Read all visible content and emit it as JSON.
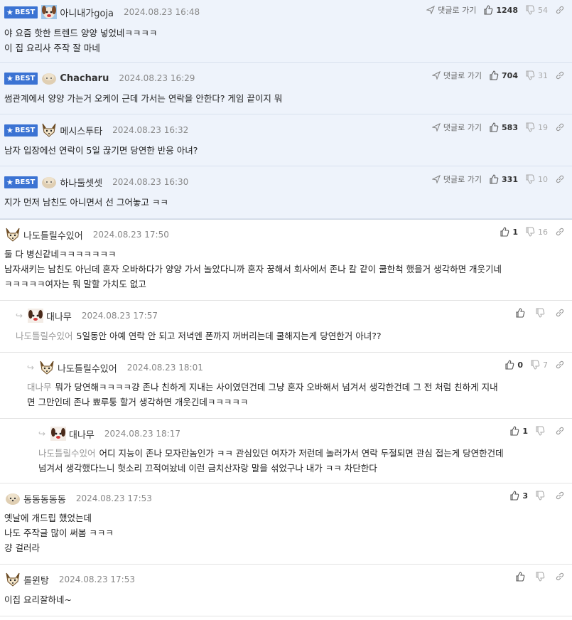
{
  "labels": {
    "best": "BEST",
    "goto": "댓글로 가기"
  },
  "best_comments": [
    {
      "nick": "아니내가goja",
      "date": "2024.08.23 16:48",
      "up": "1248",
      "down": "54",
      "text": "야 요즘 핫한 트렌드 양양 넣었네ㅋㅋㅋㅋ\n이 집 요리사 주작 잘 마네",
      "avatar": "dog-red-avatar"
    },
    {
      "nick": "Chacharu",
      "date": "2024.08.23 16:29",
      "up": "704",
      "down": "31",
      "text": "썸관계에서 양양 가는거 오케이 근데 가서는 연락을 안한다? 게임 끝이지 뭐",
      "avatar": "beige-dog-avatar"
    },
    {
      "nick": "메시스투타",
      "date": "2024.08.23 16:32",
      "up": "583",
      "down": "19",
      "text": "남자 입장에선 연락이 5일 끊기면 당연한 반응 아녀?",
      "avatar": "fox-avatar"
    },
    {
      "nick": "하나둘셋셋",
      "date": "2024.08.23 16:30",
      "up": "331",
      "down": "10",
      "text": "지가 먼저 남친도 아니면서 선 그어놓고 ㅋㅋ",
      "avatar": "beige-dog-avatar"
    }
  ],
  "comments": [
    {
      "nick": "나도틀릴수있어",
      "date": "2024.08.23 17:50",
      "up": "1",
      "down": "16",
      "depth": 0,
      "mention": "",
      "text": "둘 다 병신같네ㅋㅋㅋㅋㅋㅋㅋ\n남자새키는 남친도 아닌데 혼자 오바하다가 양양 가서 놀았다니까 혼자 꿍해서 회사에서 존나 칼 같이 쿨한척 했을거 생각하면 개웃기네\nㅋㅋㅋㅋㅋ여자는 뭐 말할 가치도 없고",
      "avatar": "fox-avatar"
    },
    {
      "nick": "대나무",
      "date": "2024.08.23 17:57",
      "up": "",
      "down": "",
      "depth": 1,
      "mention": "나도틀릴수있어",
      "text": "5일동안 아예 연락 안 되고 저녁엔 폰까지 꺼버리는데 쿨해지는게 당연한거 아녀??",
      "avatar": "dog-red-avatar"
    },
    {
      "nick": "나도틀릴수있어",
      "date": "2024.08.23 18:01",
      "up": "0",
      "down": "7",
      "depth": 2,
      "mention": "대나무",
      "text": "뭐가 당연해ㅋㅋㅋㅋ걍 존나 친하게 지내는 사이였던건데 그냥 혼자 오바해서 넘겨서 생각한건데 그 전 처럼 친하게 지내\n면 그만인데 존나 뾰루퉁 할거 생각하면 개웃긴데ㅋㅋㅋㅋㅋ",
      "avatar": "fox-avatar"
    },
    {
      "nick": "대나무",
      "date": "2024.08.23 18:17",
      "up": "1",
      "down": "",
      "depth": 3,
      "mention": "나도틀릴수있어",
      "text": "어디 지능이 존나 모자란놈인가 ㅋㅋ 관심있던 여자가 저런데 놀러가서 연락 두절되면 관심 접는게 당연한건데\n넘겨서 생각했다느니 헛소리 끄적여놨네 이런 금치산자랑 말을 섞었구나 내가 ㅋㅋ 차단한다",
      "avatar": "dog-red-avatar"
    },
    {
      "nick": "동동동동동",
      "date": "2024.08.23 17:53",
      "up": "3",
      "down": "",
      "depth": 0,
      "mention": "",
      "text": "옛날에 개드립 했었는데\n나도 주작글 많이 써봄 ㅋㅋㅋ\n걍 걸러라",
      "avatar": "beige-dog-avatar"
    },
    {
      "nick": "롤윈탕",
      "date": "2024.08.23 17:53",
      "up": "",
      "down": "",
      "depth": 0,
      "mention": "",
      "text": "이집 요리잘하네~",
      "avatar": "fox-avatar"
    }
  ]
}
